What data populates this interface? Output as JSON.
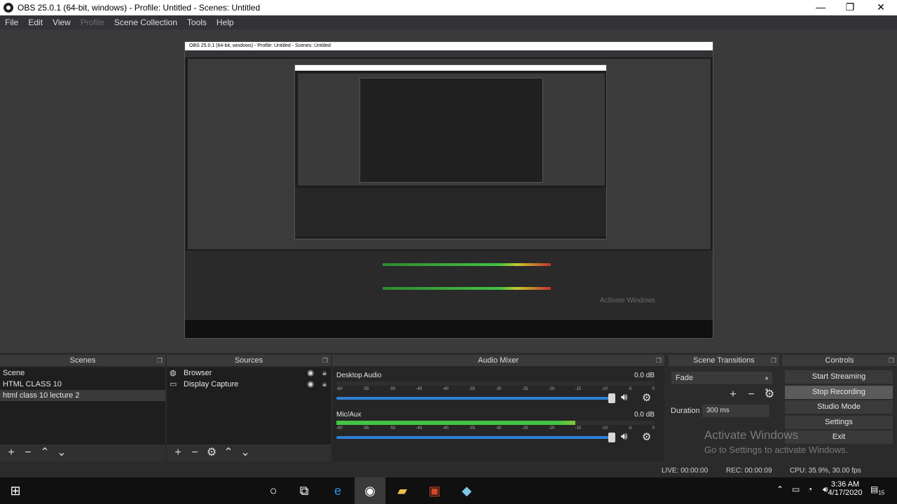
{
  "window": {
    "title": "OBS 25.0.1 (64-bit, windows) - Profile: Untitled - Scenes: Untitled",
    "minimize": "—",
    "maximize": "❐",
    "close": "✕"
  },
  "menu": {
    "items": [
      "File",
      "Edit",
      "View",
      "Profile",
      "Scene Collection",
      "Tools",
      "Help"
    ]
  },
  "docks": {
    "scenes": {
      "title": "Scenes",
      "items": [
        "Scene",
        "HTML CLASS 10",
        "html class 10 lecture 2"
      ],
      "selected_index": 2
    },
    "sources": {
      "title": "Sources",
      "items": [
        {
          "name": "Browser",
          "icon": "globe-icon"
        },
        {
          "name": "Display Capture",
          "icon": "monitor-icon"
        }
      ]
    },
    "mixer": {
      "title": "Audio Mixer",
      "channels": [
        {
          "name": "Desktop Audio",
          "db": "0.0 dB",
          "level": 0.0
        },
        {
          "name": "Mic/Aux",
          "db": "0.0 dB",
          "level": 0.75
        }
      ],
      "ticks": [
        "-60",
        "-55",
        "-50",
        "-45",
        "-40",
        "-35",
        "-30",
        "-25",
        "-20",
        "-15",
        "-10",
        "-5",
        "0"
      ]
    },
    "transitions": {
      "title": "Scene Transitions",
      "selected": "Fade",
      "duration_label": "Duration",
      "duration_value": "300 ms"
    },
    "controls": {
      "title": "Controls",
      "buttons": [
        "Start Streaming",
        "Stop Recording",
        "Studio Mode",
        "Settings",
        "Exit"
      ]
    }
  },
  "status": {
    "live": "LIVE: 00:00:00",
    "rec": "REC: 00:00:09",
    "cpu": "CPU: 35.9%, 30.00 fps"
  },
  "activation": {
    "line1": "Activate Windows",
    "line2": "Go to Settings to activate Windows."
  },
  "taskbar": {
    "time": "3:36 AM",
    "date": "4/17/2020",
    "notification_count": "15"
  },
  "colors": {
    "accent_blue": "#2f7fd6",
    "meter_green": "#44c444",
    "meter_yellow": "#c9c92a",
    "meter_red": "#c43030"
  }
}
